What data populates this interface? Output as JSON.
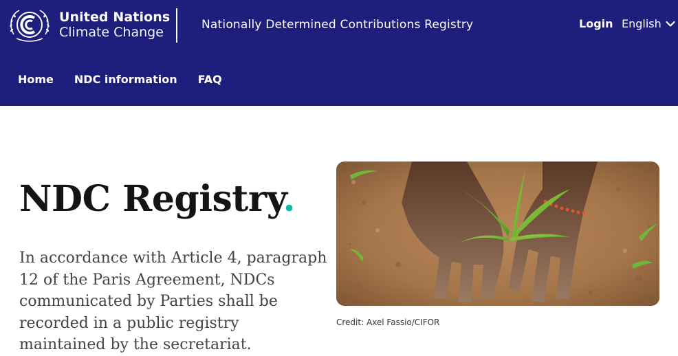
{
  "header": {
    "org_line1": "United Nations",
    "org_line2": "Climate Change",
    "registry_title": "Nationally Determined Contributions Registry",
    "login_label": "Login",
    "language": "English",
    "nav": [
      {
        "label": "Home"
      },
      {
        "label": "NDC information"
      },
      {
        "label": "FAQ"
      }
    ],
    "colors": {
      "header_bg": "#1e1e7c",
      "accent": "#16b5a6"
    }
  },
  "hero": {
    "title": "NDC Registry",
    "title_dot": ".",
    "intro": "In accordance with Article 4, paragraph 12 of the Paris Agreement, NDCs communicated by Parties shall be recorded in a public registry maintained by the secretariat.",
    "image_credit": "Credit: Axel Fassio/CIFOR"
  },
  "icons": {
    "logo": "un-climate-emblem-icon",
    "language_dropdown": "chevron-down-icon"
  }
}
